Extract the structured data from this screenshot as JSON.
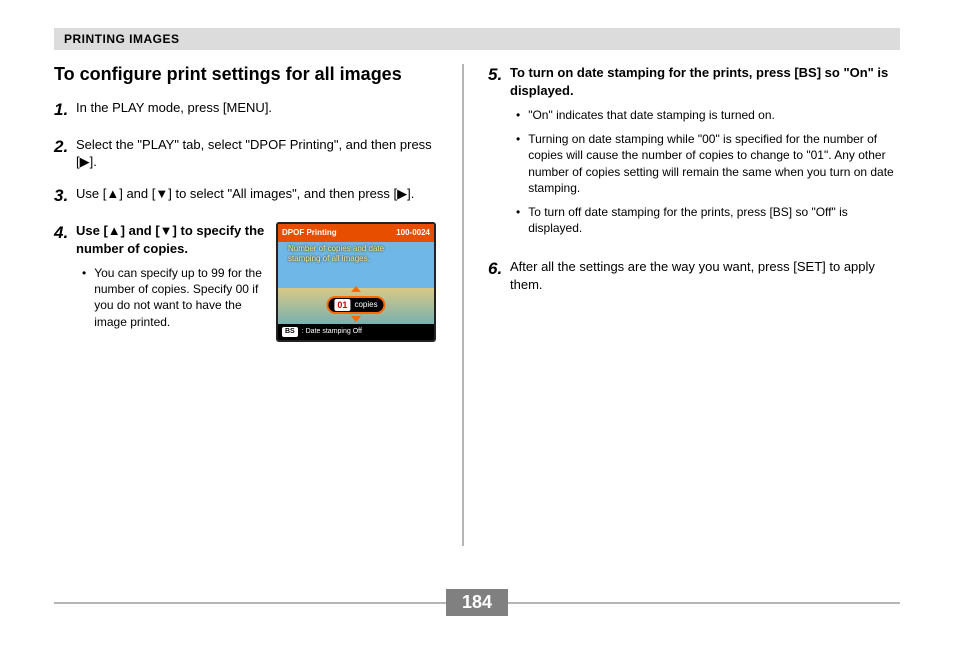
{
  "header": "PRINTING IMAGES",
  "title": "To configure print settings for all images",
  "glyphs": {
    "up": "▲",
    "down": "▼",
    "right": "▶"
  },
  "steps": {
    "s1": {
      "n": "1.",
      "t": "In the PLAY mode, press [MENU]."
    },
    "s2": {
      "n": "2.",
      "pre": "Select the \"PLAY\" tab, select \"DPOF Printing\", and then press [",
      "post": "]."
    },
    "s3": {
      "n": "3.",
      "pre": "Use [",
      "mid": "] and [",
      "post": "] to select \"All images\", and then press [",
      "end": "]."
    },
    "s4": {
      "n": "4.",
      "pre": "Use [",
      "mid": "] and [",
      "post": "] to specify the number of copies.",
      "b1": "You can specify up to 99 for the number of copies. Specify 00 if you do not want to have the image printed."
    },
    "s5": {
      "n": "5.",
      "t": "To turn on date stamping for the prints, press [BS] so \"On\" is displayed.",
      "b1": "\"On\" indicates that date stamping is turned on.",
      "b2": "Turning on date stamping while \"00\" is specified for the number of copies will cause the number of copies to change to \"01\". Any other number of copies setting will remain the same when you turn on date stamping.",
      "b3": "To turn off date stamping for the prints, press [BS] so \"Off\" is displayed."
    },
    "s6": {
      "n": "6.",
      "t": "After all the settings are the way you want, press [SET] to apply them."
    }
  },
  "lcd": {
    "topLeft": "DPOF Printing",
    "topRight": "100-0024",
    "msg1": "Number of copies and date",
    "msg2": "stamping of all images.",
    "num": "01",
    "copies": "copies",
    "bs": "BS",
    "stamp": ": Date stamping Off"
  },
  "pageNumber": "184"
}
